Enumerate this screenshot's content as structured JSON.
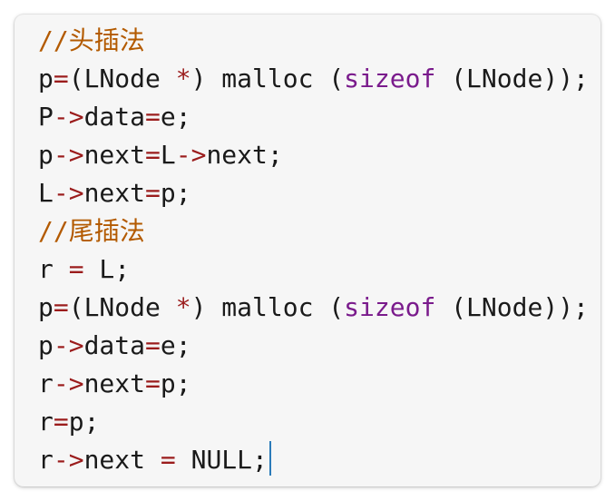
{
  "editor": {
    "lines": [
      [
        {
          "t": "//头插法",
          "k": "comment"
        }
      ],
      [
        {
          "t": "p",
          "k": "text"
        },
        {
          "t": "=",
          "k": "op"
        },
        {
          "t": "(LNode ",
          "k": "text"
        },
        {
          "t": "*",
          "k": "op"
        },
        {
          "t": ") malloc (",
          "k": "text"
        },
        {
          "t": "sizeof",
          "k": "keyword"
        },
        {
          "t": " (LNode));",
          "k": "text"
        }
      ],
      [
        {
          "t": "P",
          "k": "text"
        },
        {
          "t": "->",
          "k": "op"
        },
        {
          "t": "data",
          "k": "text"
        },
        {
          "t": "=",
          "k": "op"
        },
        {
          "t": "e;",
          "k": "text"
        }
      ],
      [
        {
          "t": "p",
          "k": "text"
        },
        {
          "t": "->",
          "k": "op"
        },
        {
          "t": "next",
          "k": "text"
        },
        {
          "t": "=",
          "k": "op"
        },
        {
          "t": "L",
          "k": "text"
        },
        {
          "t": "->",
          "k": "op"
        },
        {
          "t": "next;",
          "k": "text"
        }
      ],
      [
        {
          "t": "L",
          "k": "text"
        },
        {
          "t": "->",
          "k": "op"
        },
        {
          "t": "next",
          "k": "text"
        },
        {
          "t": "=",
          "k": "op"
        },
        {
          "t": "p;",
          "k": "text"
        }
      ],
      [
        {
          "t": "//尾插法",
          "k": "comment"
        }
      ],
      [
        {
          "t": "r ",
          "k": "text"
        },
        {
          "t": "=",
          "k": "op"
        },
        {
          "t": " L;",
          "k": "text"
        }
      ],
      [
        {
          "t": "p",
          "k": "text"
        },
        {
          "t": "=",
          "k": "op"
        },
        {
          "t": "(LNode ",
          "k": "text"
        },
        {
          "t": "*",
          "k": "op"
        },
        {
          "t": ") malloc (",
          "k": "text"
        },
        {
          "t": "sizeof",
          "k": "keyword"
        },
        {
          "t": " (LNode));",
          "k": "text"
        }
      ],
      [
        {
          "t": "p",
          "k": "text"
        },
        {
          "t": "->",
          "k": "op"
        },
        {
          "t": "data",
          "k": "text"
        },
        {
          "t": "=",
          "k": "op"
        },
        {
          "t": "e;",
          "k": "text"
        }
      ],
      [
        {
          "t": "r",
          "k": "text"
        },
        {
          "t": "->",
          "k": "op"
        },
        {
          "t": "next",
          "k": "text"
        },
        {
          "t": "=",
          "k": "op"
        },
        {
          "t": "p;",
          "k": "text"
        }
      ],
      [
        {
          "t": "r",
          "k": "text"
        },
        {
          "t": "=",
          "k": "op"
        },
        {
          "t": "p;",
          "k": "text"
        }
      ],
      [
        {
          "t": "r",
          "k": "text"
        },
        {
          "t": "->",
          "k": "op"
        },
        {
          "t": "next ",
          "k": "text"
        },
        {
          "t": "=",
          "k": "op"
        },
        {
          "t": " NULL;",
          "k": "text"
        }
      ]
    ],
    "cursor_line": 11,
    "colors": {
      "comment": "#b35a00",
      "operator": "#9b1c1c",
      "keyword": "#7a1b8c",
      "text": "#1a1a1a",
      "cursor": "#2b7bb9",
      "background": "#f6f6f6"
    }
  }
}
